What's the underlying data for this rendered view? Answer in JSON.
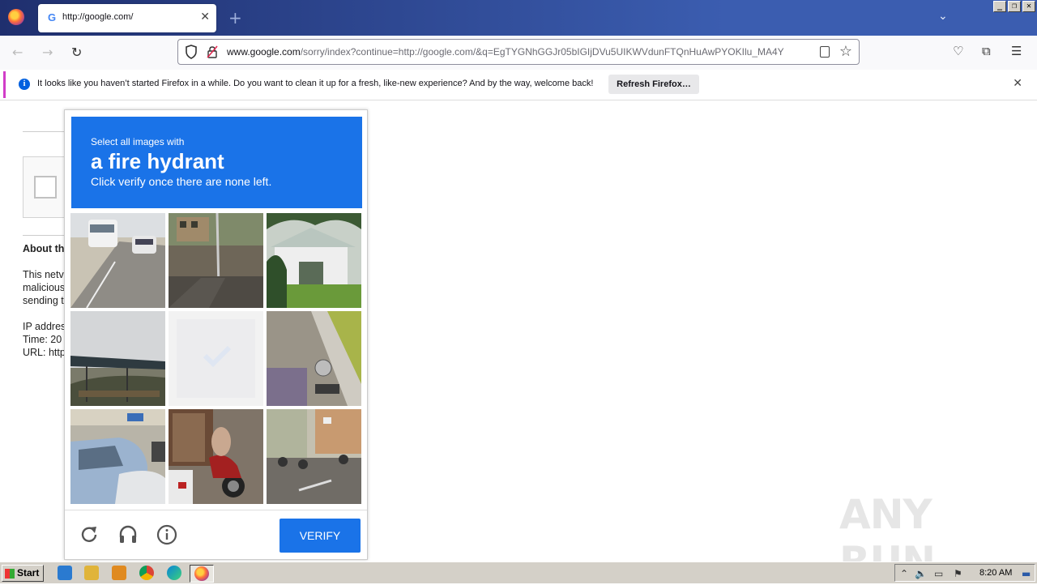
{
  "browser": {
    "tab": {
      "favicon": "G",
      "title": "http://google.com/"
    },
    "url": {
      "host": "www.google.com",
      "rest": "/sorry/index?continue=http://google.com/&q=EgTYGNhGGJr05bIGIjDVu5UIKWVdunFTQnHuAwPYOKIlu_MA4Y"
    },
    "notification": {
      "message": "It looks like you haven’t started Firefox in a while. Do you want to clean it up for a fresh, like-new experience? And by the way, welcome back!",
      "button": "Refresh Firefox…"
    }
  },
  "background_page": {
    "about_heading": "About th",
    "lines": [
      "This netv",
      "malicious",
      "sending t"
    ],
    "info": [
      "IP addres",
      "Time: 20",
      "URL: http"
    ]
  },
  "captcha": {
    "instruction_small": "Select all images with",
    "target": "a fire hydrant",
    "instruction_sub": "Click verify once there are none left.",
    "tiles": [
      {
        "name": "tile-bus-road",
        "selected": false
      },
      {
        "name": "tile-street-pole",
        "selected": false
      },
      {
        "name": "tile-house-trees",
        "selected": false
      },
      {
        "name": "tile-shelter",
        "selected": false
      },
      {
        "name": "tile-faded",
        "selected": true
      },
      {
        "name": "tile-sidewalk",
        "selected": false
      },
      {
        "name": "tile-cars",
        "selected": false
      },
      {
        "name": "tile-motorbike",
        "selected": false
      },
      {
        "name": "tile-street-scene",
        "selected": false
      }
    ],
    "verify_label": "VERIFY",
    "accent": "#1a73e8"
  },
  "watermark": "ANY RUN",
  "taskbar": {
    "start_label": "Start",
    "clock": "8:20 AM"
  }
}
